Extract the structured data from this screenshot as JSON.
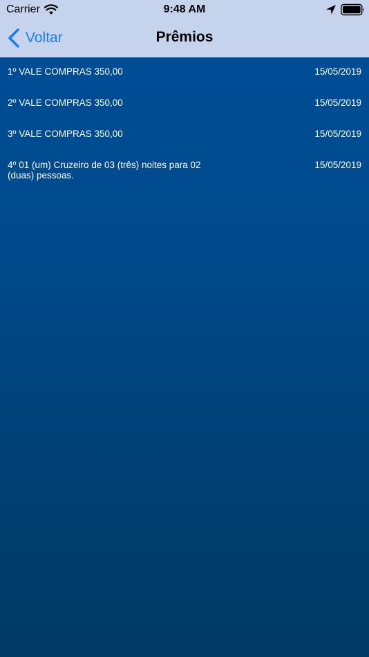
{
  "status_bar": {
    "carrier": "Carrier",
    "time": "9:48 AM",
    "icons": [
      "wifi-icon",
      "location-arrow-icon",
      "battery-icon"
    ]
  },
  "nav": {
    "back_label": "Voltar",
    "title": "Prêmios",
    "accent_color": "#1a7cf4"
  },
  "prizes": [
    {
      "desc": "1º VALE COMPRAS 350,00",
      "date": "15/05/2019"
    },
    {
      "desc": "2º VALE COMPRAS 350,00",
      "date": "15/05/2019"
    },
    {
      "desc": "3º VALE COMPRAS 350,00",
      "date": "15/05/2019"
    },
    {
      "desc": "4º 01 (um) Cruzeiro de 03 (três) noites para 02 (duas) pessoas.",
      "date": "15/05/2019"
    }
  ],
  "colors": {
    "header_bg": "#c5d3ec",
    "content_top": "#004d96",
    "content_bottom": "#003a63"
  }
}
